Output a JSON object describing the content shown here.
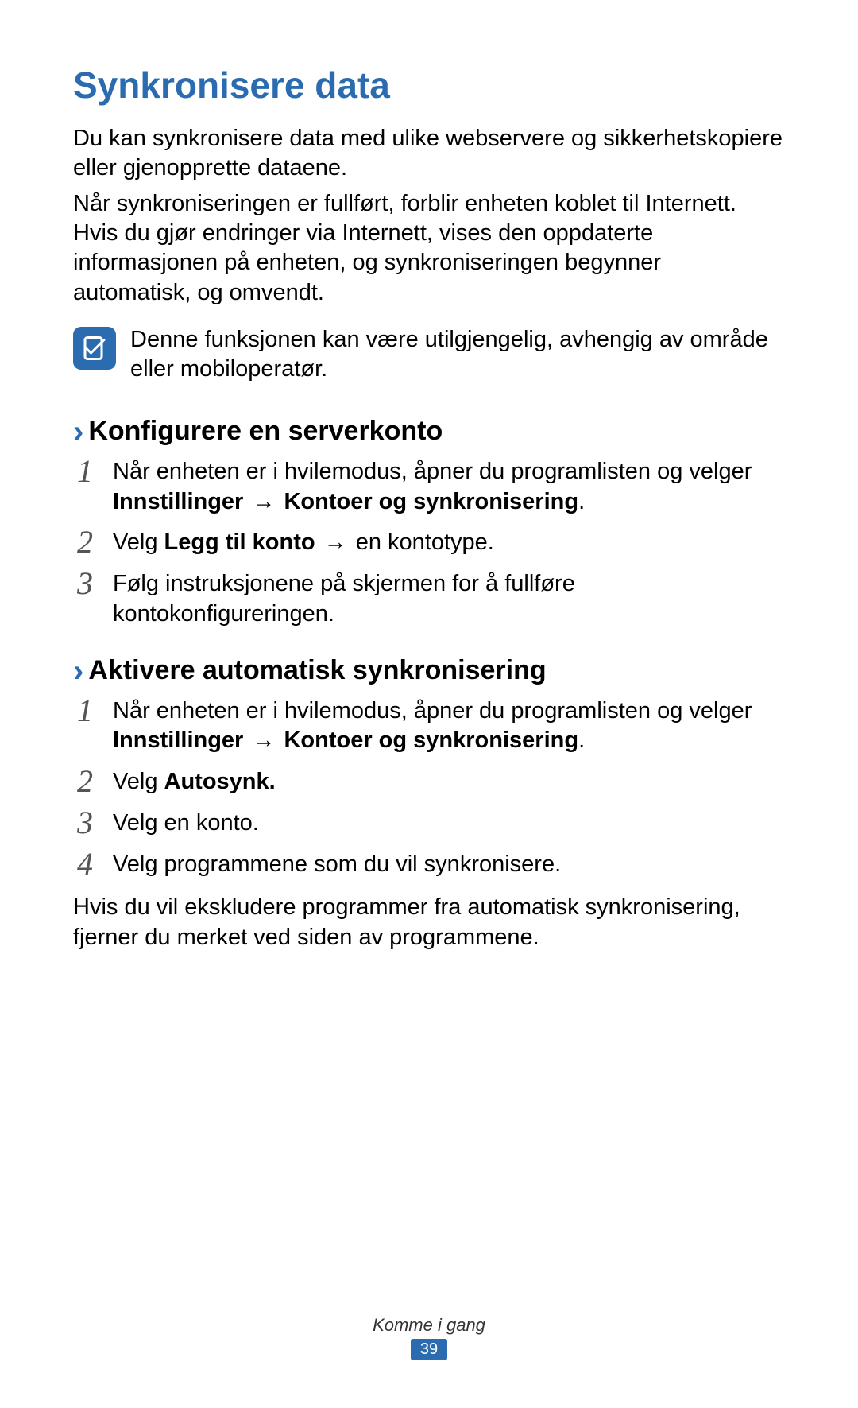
{
  "heading": "Synkronisere data",
  "intro": [
    "Du kan synkronisere data med ulike webservere og sikkerhetskopiere eller gjenopprette dataene.",
    "Når synkroniseringen er fullført, forblir enheten koblet til Internett. Hvis du gjør endringer via Internett, vises den oppdaterte informasjonen på enheten, og synkroniseringen begynner automatisk, og omvendt."
  ],
  "note": "Denne funksjonen kan være utilgjengelig, avhengig av område eller mobiloperatør.",
  "sections": [
    {
      "title": "Konfigurere en serverkonto",
      "steps": [
        {
          "num": "1",
          "pre": "Når enheten er i hvilemodus, åpner du programlisten og velger ",
          "b1": "Innstillinger",
          "arrow": " → ",
          "b2": "Kontoer og synkronisering",
          "post": "."
        },
        {
          "num": "2",
          "pre": "Velg ",
          "b1": "Legg til konto",
          "arrow": " → ",
          "post": "en kontotype."
        },
        {
          "num": "3",
          "pre": "Følg instruksjonene på skjermen for å fullføre kontokonfigureringen."
        }
      ]
    },
    {
      "title": "Aktivere automatisk synkronisering",
      "steps": [
        {
          "num": "1",
          "pre": "Når enheten er i hvilemodus, åpner du programlisten og velger ",
          "b1": "Innstillinger",
          "arrow": " → ",
          "b2": "Kontoer og synkronisering",
          "post": "."
        },
        {
          "num": "2",
          "pre": "Velg ",
          "b1": "Autosynk."
        },
        {
          "num": "3",
          "pre": "Velg en konto."
        },
        {
          "num": "4",
          "pre": "Velg programmene som du vil synkronisere."
        }
      ],
      "trail": "Hvis du vil ekskludere programmer fra automatisk synkronisering, fjerner du merket ved siden av programmene."
    }
  ],
  "footer": {
    "chapter": "Komme i gang",
    "page": "39"
  }
}
